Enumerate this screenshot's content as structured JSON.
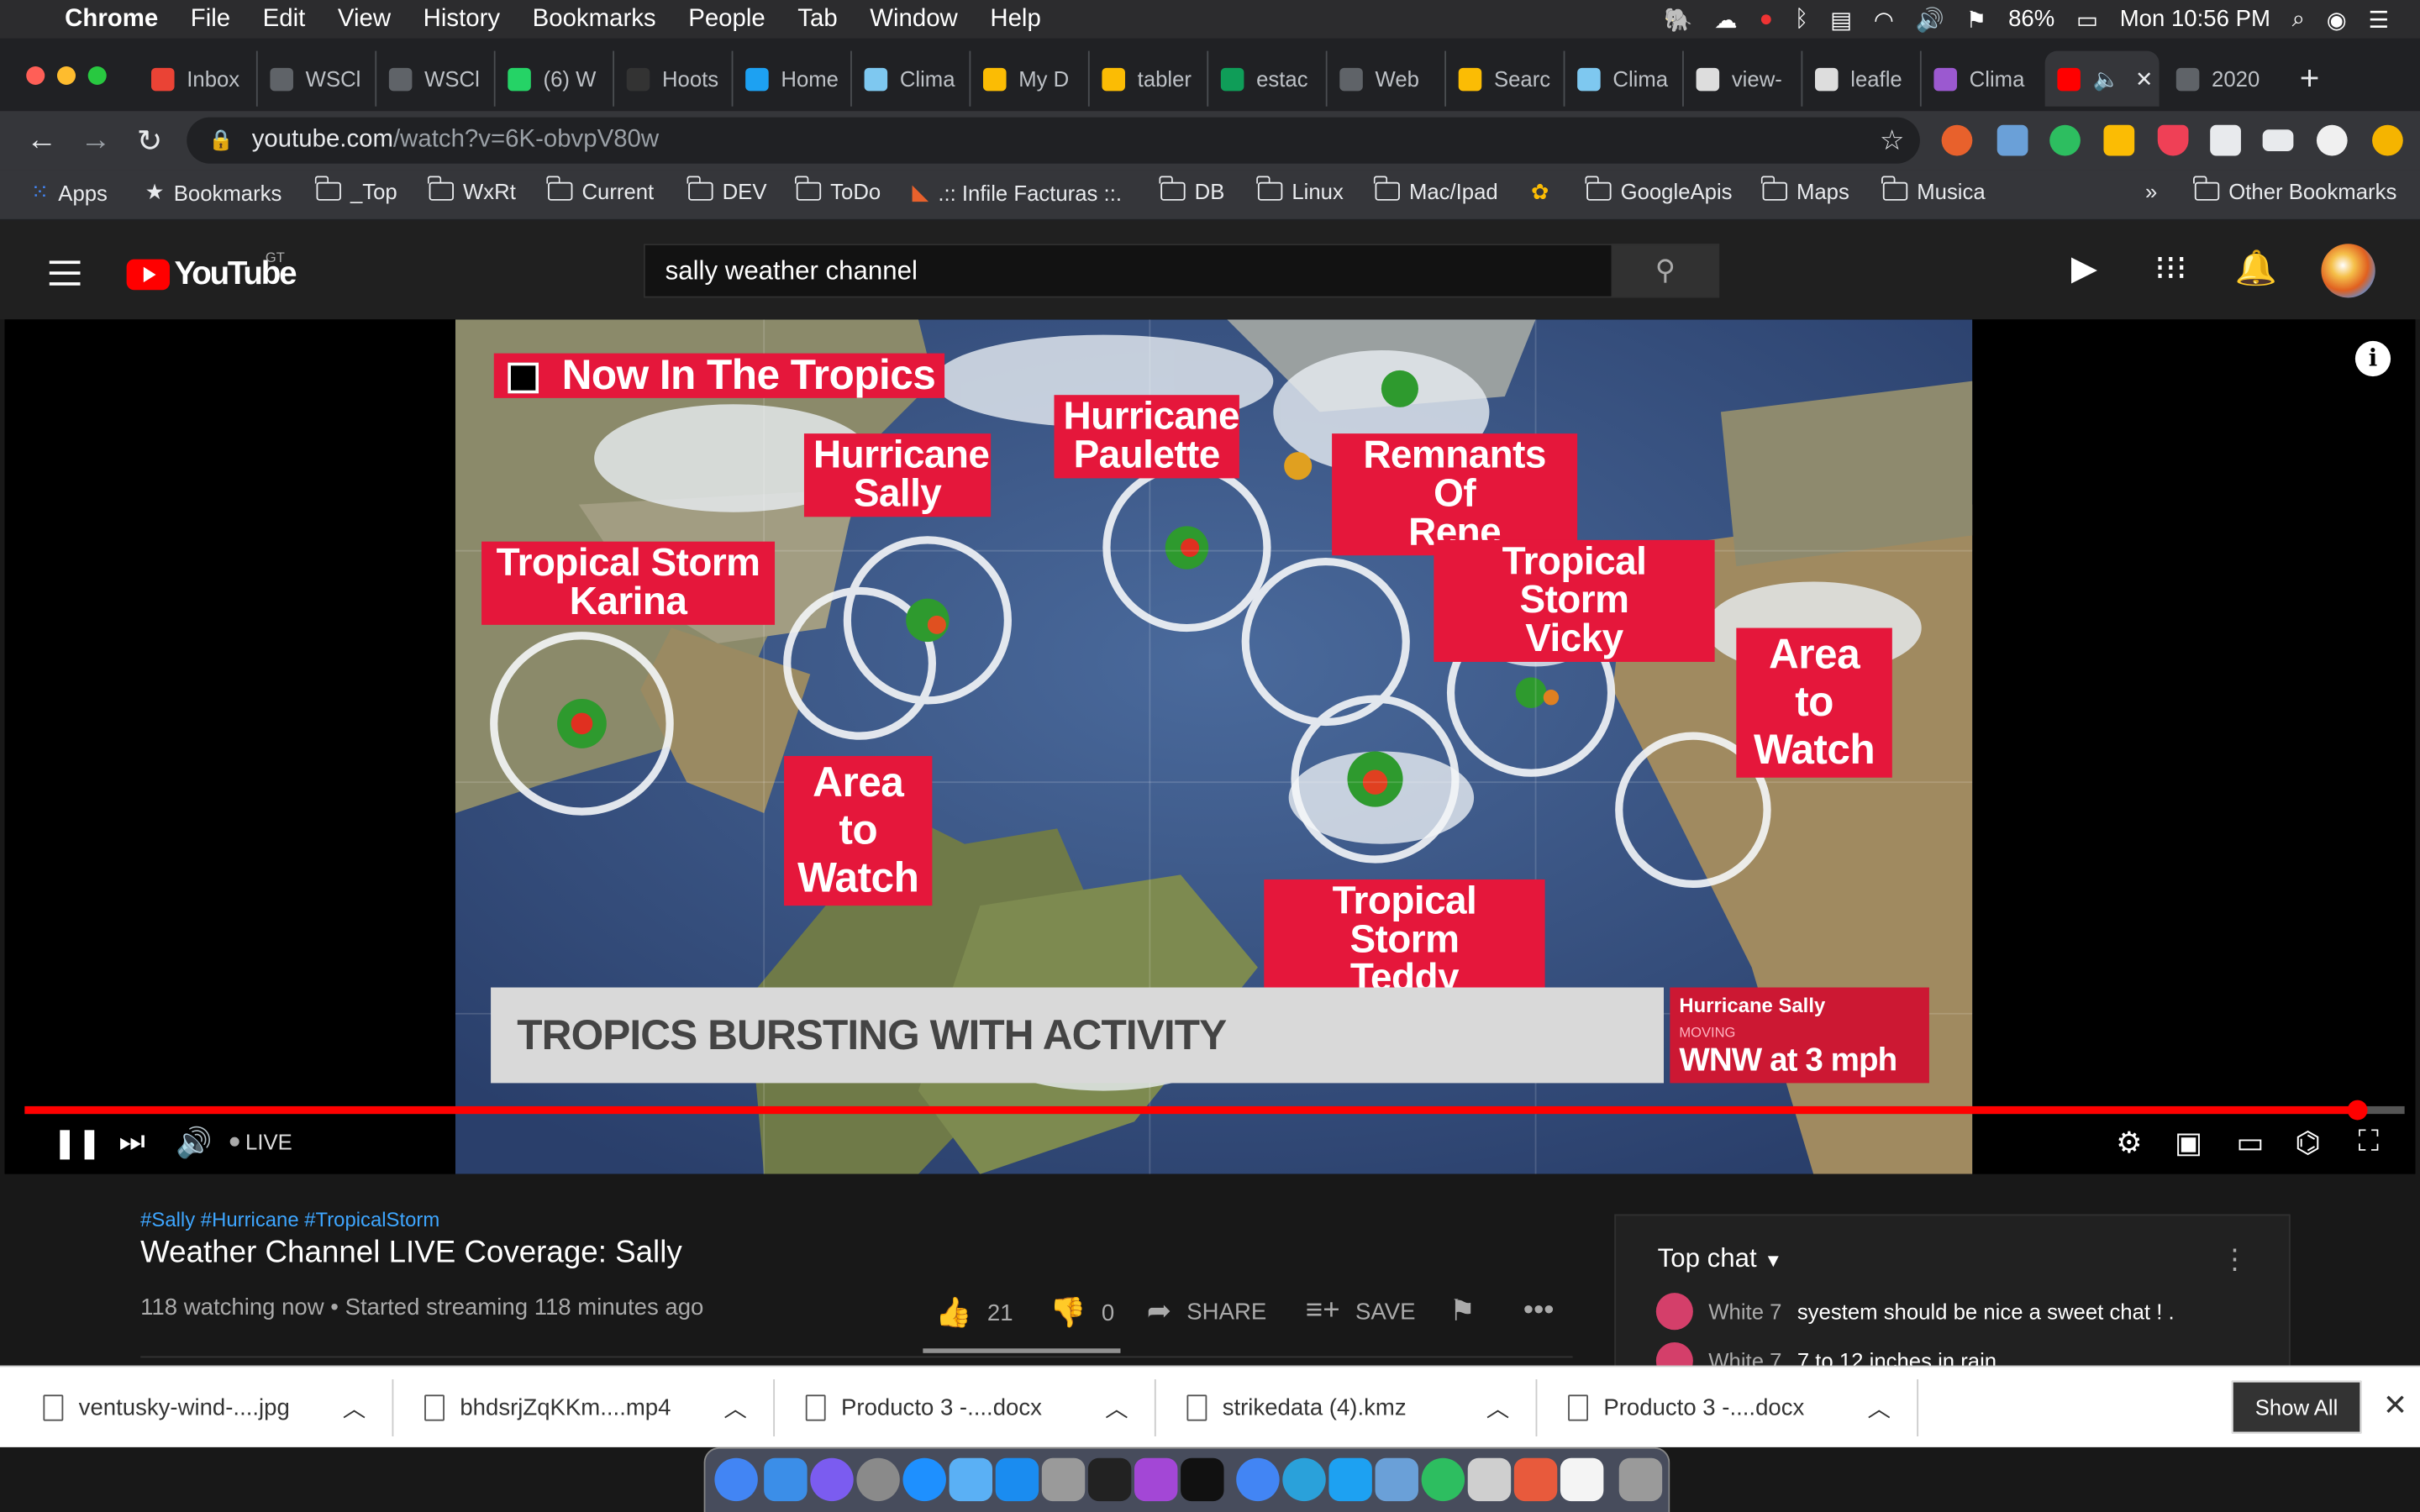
{
  "menubar": {
    "app": "Chrome",
    "items": [
      "File",
      "Edit",
      "View",
      "History",
      "Bookmarks",
      "People",
      "Tab",
      "Window",
      "Help"
    ],
    "battery": "86%",
    "clock": "Mon 10:56 PM"
  },
  "tabs": [
    {
      "label": "Inbox",
      "color": "#ea4335"
    },
    {
      "label": "WSCl",
      "color": "#5f6368"
    },
    {
      "label": "WSCl",
      "color": "#5f6368"
    },
    {
      "label": "(6) W",
      "color": "#25d366"
    },
    {
      "label": "Hoots",
      "color": "#333333"
    },
    {
      "label": "Home",
      "color": "#1da1f2"
    },
    {
      "label": "Clima",
      "color": "#7ec8f0"
    },
    {
      "label": "My D",
      "color": "#fbbc04"
    },
    {
      "label": "tabler",
      "color": "#fbbc04"
    },
    {
      "label": "estac",
      "color": "#0f9d58"
    },
    {
      "label": "Web",
      "color": "#5f6368"
    },
    {
      "label": "Searc",
      "color": "#fbbc04"
    },
    {
      "label": "Clima",
      "color": "#7ec8f0"
    },
    {
      "label": "view-",
      "color": "#dddddd"
    },
    {
      "label": "leafle",
      "color": "#dddddd"
    },
    {
      "label": "Clima",
      "color": "#9b59d0"
    },
    {
      "label": "",
      "color": "#ff0000"
    },
    {
      "label": "2020",
      "color": "#5f6368"
    }
  ],
  "address": {
    "host": "youtube.com",
    "path": "/watch?v=6K-obvpV80w"
  },
  "bookmarks": [
    {
      "label": "Apps",
      "icon": "apps-icon"
    },
    {
      "label": "Bookmarks",
      "icon": "star-icon"
    },
    {
      "label": "_Top",
      "icon": "folder-icon"
    },
    {
      "label": "WxRt",
      "icon": "folder-icon"
    },
    {
      "label": "Current",
      "icon": "folder-icon"
    },
    {
      "label": "DEV",
      "icon": "folder-icon"
    },
    {
      "label": "ToDo",
      "icon": "folder-icon"
    },
    {
      "label": ".:: Infile Facturas ::.",
      "icon": "infile-icon"
    },
    {
      "label": "DB",
      "icon": "folder-icon"
    },
    {
      "label": "Linux",
      "icon": "folder-icon"
    },
    {
      "label": "Mac/Ipad",
      "icon": "folder-icon"
    },
    {
      "label": "",
      "icon": "photos-icon"
    },
    {
      "label": "GoogleApis",
      "icon": "folder-icon"
    },
    {
      "label": "Maps",
      "icon": "folder-icon"
    },
    {
      "label": "Musica",
      "icon": "folder-icon"
    },
    {
      "label": "»",
      "icon": "overflow-icon"
    },
    {
      "label": "Other Bookmarks",
      "icon": "folder-icon"
    }
  ],
  "youtube": {
    "logo": "YouTube",
    "region": "GT",
    "search_query": "sally weather channel"
  },
  "video": {
    "labels": {
      "now": "Now In The Tropics",
      "sally": "Hurricane\nSally",
      "paulette": "Hurricane\nPaulette",
      "rene": "Remnants Of\nRene",
      "karina": "Tropical Storm\nKarina",
      "vicky": "Tropical Storm\nVicky",
      "watch_east": "Area to\nWatch",
      "watch_gulf": "Area to\nWatch",
      "teddy": "Tropical Storm\nTeddy"
    },
    "ticker": "TROPICS BURSTING WITH ACTIVITY",
    "status_title": "Hurricane Sally",
    "status_label": "MOVING",
    "status_value": "WNW at 3 mph"
  },
  "player": {
    "live": "LIVE",
    "progress": 0.98
  },
  "info": {
    "hashtags": "#Sally #Hurricane #TropicalStorm",
    "title": "Weather Channel LIVE Coverage: Sally",
    "meta": "118 watching now • Started streaming 118 minutes ago",
    "likes": "21",
    "dislikes": "0",
    "share": "SHARE",
    "save": "SAVE"
  },
  "chat": {
    "header": "Top chat",
    "messages": [
      {
        "author": "White 7",
        "text": "syestem should be nice a sweet chat ! ."
      },
      {
        "author": "White 7",
        "text": "7 to 12 inches in rain"
      }
    ]
  },
  "downloads": {
    "items": [
      "ventusky-wind-....jpg",
      "bhdsrjZqKKm....mp4",
      "Producto 3 -....docx",
      "strikedata (4).kmz",
      "Producto 3 -....docx"
    ],
    "show_all": "Show All"
  },
  "colors": {
    "accent": "#ff0000",
    "label_red": "#e5173b",
    "link": "#3ea6ff"
  }
}
